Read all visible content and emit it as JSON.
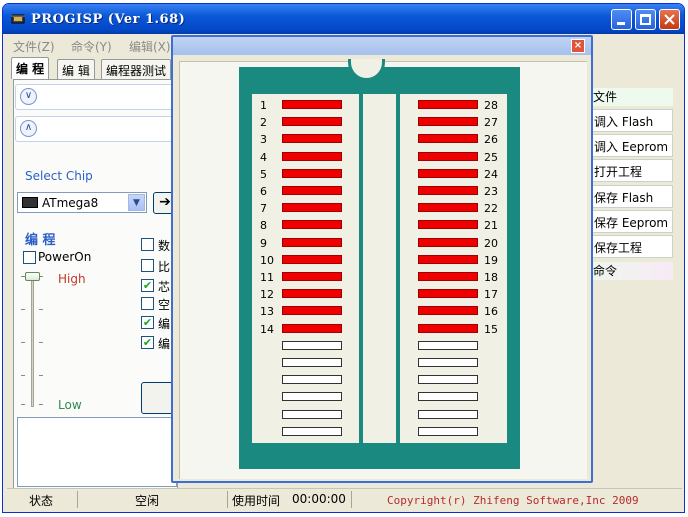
{
  "window": {
    "title": "PROGISP (Ver 1.68)"
  },
  "menu": [
    "文件(Z)",
    "命令(Y)",
    "编辑(X)"
  ],
  "tabs": [
    "编 程",
    "编 辑",
    "编程器测试"
  ],
  "select_chip": {
    "label": "Select Chip",
    "value": "ATmega8"
  },
  "programming": {
    "header": "编 程",
    "poweron_label": "PowerOn",
    "high_label": "High",
    "low_label": "Low",
    "options": [
      {
        "label": "数",
        "checked": false
      },
      {
        "label": "比",
        "checked": false
      },
      {
        "label": "芯",
        "checked": true
      },
      {
        "label": "空",
        "checked": false
      },
      {
        "label": "编",
        "checked": true
      },
      {
        "label": "编",
        "checked": true
      }
    ]
  },
  "right_panel": {
    "file_header": "文件",
    "buttons": [
      "调入 Flash",
      "调入 Eeprom",
      "打开工程",
      "保存 Flash",
      "保存 Eeprom",
      "保存工程"
    ],
    "command_header": "命令"
  },
  "status": {
    "state_label": "状态",
    "state_value": "空闲",
    "time_label": "使用时间",
    "time_value": "00:00:00",
    "copyright": "Copyright(r) Zhifeng Software,Inc 2009"
  },
  "popup": {
    "close_glyph": "×",
    "left_pins": [
      {
        "num": "1",
        "active": true
      },
      {
        "num": "2",
        "active": true
      },
      {
        "num": "3",
        "active": true
      },
      {
        "num": "4",
        "active": true
      },
      {
        "num": "5",
        "active": true
      },
      {
        "num": "6",
        "active": true
      },
      {
        "num": "7",
        "active": true
      },
      {
        "num": "8",
        "active": true
      },
      {
        "num": "9",
        "active": true
      },
      {
        "num": "10",
        "active": true
      },
      {
        "num": "11",
        "active": true
      },
      {
        "num": "12",
        "active": true
      },
      {
        "num": "13",
        "active": true
      },
      {
        "num": "14",
        "active": true
      },
      {
        "num": "",
        "active": false
      },
      {
        "num": "",
        "active": false
      },
      {
        "num": "",
        "active": false
      },
      {
        "num": "",
        "active": false
      },
      {
        "num": "",
        "active": false
      },
      {
        "num": "",
        "active": false
      }
    ],
    "right_pins": [
      {
        "num": "28",
        "active": true
      },
      {
        "num": "27",
        "active": true
      },
      {
        "num": "26",
        "active": true
      },
      {
        "num": "25",
        "active": true
      },
      {
        "num": "24",
        "active": true
      },
      {
        "num": "23",
        "active": true
      },
      {
        "num": "22",
        "active": true
      },
      {
        "num": "21",
        "active": true
      },
      {
        "num": "20",
        "active": true
      },
      {
        "num": "19",
        "active": true
      },
      {
        "num": "18",
        "active": true
      },
      {
        "num": "17",
        "active": true
      },
      {
        "num": "16",
        "active": true
      },
      {
        "num": "15",
        "active": true
      },
      {
        "num": "",
        "active": false
      },
      {
        "num": "",
        "active": false
      },
      {
        "num": "",
        "active": false
      },
      {
        "num": "",
        "active": false
      },
      {
        "num": "",
        "active": false
      },
      {
        "num": "",
        "active": false
      }
    ]
  },
  "colors": {
    "pin_active": "#ee0000",
    "pin_inactive": "#ffffff",
    "chip_frame": "#1a8a80",
    "titlebar": "#0a58d8"
  },
  "icons": {
    "app": "chip-icon",
    "expand": "double-chevron-down-icon",
    "collapse": "double-chevron-up-icon",
    "go": "arrow-right-icon"
  }
}
